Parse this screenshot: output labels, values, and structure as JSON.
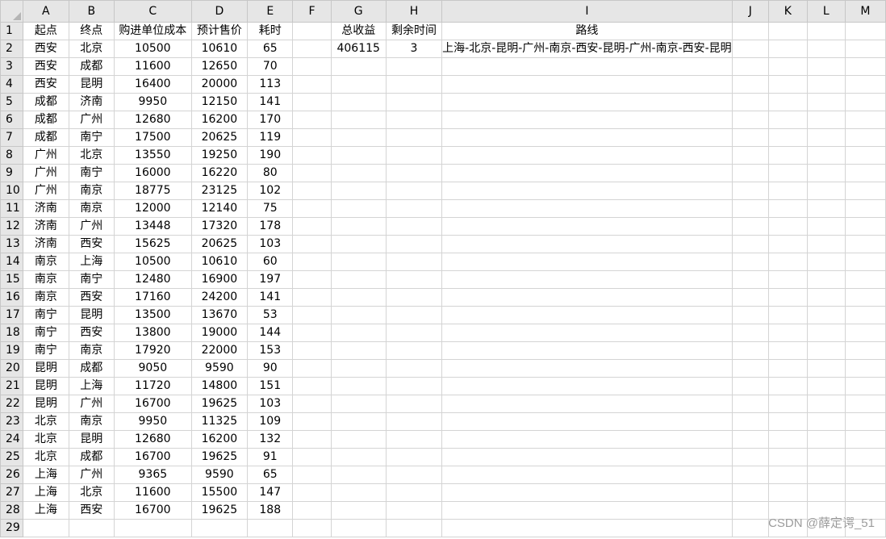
{
  "columns": [
    "A",
    "B",
    "C",
    "D",
    "E",
    "F",
    "G",
    "H",
    "I",
    "J",
    "K",
    "L",
    "M"
  ],
  "row_numbers": [
    "1",
    "2",
    "3",
    "4",
    "5",
    "6",
    "7",
    "8",
    "9",
    "10",
    "11",
    "12",
    "13",
    "14",
    "15",
    "16",
    "17",
    "18",
    "19",
    "20",
    "21",
    "22",
    "23",
    "24",
    "25",
    "26",
    "27",
    "28",
    "29"
  ],
  "headers": {
    "A": "起点",
    "B": "终点",
    "C": "购进单位成本",
    "D": "预计售价",
    "E": "耗时",
    "G": "总收益",
    "H": "剩余时间",
    "I": "路线"
  },
  "result": {
    "total_revenue": "406115",
    "remaining_time": "3",
    "route": "上海-北京-昆明-广州-南京-西安-昆明-广州-南京-西安-昆明"
  },
  "rows": [
    [
      "西安",
      "北京",
      "10500",
      "10610",
      "65"
    ],
    [
      "西安",
      "成都",
      "11600",
      "12650",
      "70"
    ],
    [
      "西安",
      "昆明",
      "16400",
      "20000",
      "113"
    ],
    [
      "成都",
      "济南",
      "9950",
      "12150",
      "141"
    ],
    [
      "成都",
      "广州",
      "12680",
      "16200",
      "170"
    ],
    [
      "成都",
      "南宁",
      "17500",
      "20625",
      "119"
    ],
    [
      "广州",
      "北京",
      "13550",
      "19250",
      "190"
    ],
    [
      "广州",
      "南宁",
      "16000",
      "16220",
      "80"
    ],
    [
      "广州",
      "南京",
      "18775",
      "23125",
      "102"
    ],
    [
      "济南",
      "南京",
      "12000",
      "12140",
      "75"
    ],
    [
      "济南",
      "广州",
      "13448",
      "17320",
      "178"
    ],
    [
      "济南",
      "西安",
      "15625",
      "20625",
      "103"
    ],
    [
      "南京",
      "上海",
      "10500",
      "10610",
      "60"
    ],
    [
      "南京",
      "南宁",
      "12480",
      "16900",
      "197"
    ],
    [
      "南京",
      "西安",
      "17160",
      "24200",
      "141"
    ],
    [
      "南宁",
      "昆明",
      "13500",
      "13670",
      "53"
    ],
    [
      "南宁",
      "西安",
      "13800",
      "19000",
      "144"
    ],
    [
      "南宁",
      "南京",
      "17920",
      "22000",
      "153"
    ],
    [
      "昆明",
      "成都",
      "9050",
      "9590",
      "90"
    ],
    [
      "昆明",
      "上海",
      "11720",
      "14800",
      "151"
    ],
    [
      "昆明",
      "广州",
      "16700",
      "19625",
      "103"
    ],
    [
      "北京",
      "南京",
      "9950",
      "11325",
      "109"
    ],
    [
      "北京",
      "昆明",
      "12680",
      "16200",
      "132"
    ],
    [
      "北京",
      "成都",
      "16700",
      "19625",
      "91"
    ],
    [
      "上海",
      "广州",
      "9365",
      "9590",
      "65"
    ],
    [
      "上海",
      "北京",
      "11600",
      "15500",
      "147"
    ],
    [
      "上海",
      "西安",
      "16700",
      "19625",
      "188"
    ]
  ],
  "watermark": "CSDN @薛定谔_51"
}
